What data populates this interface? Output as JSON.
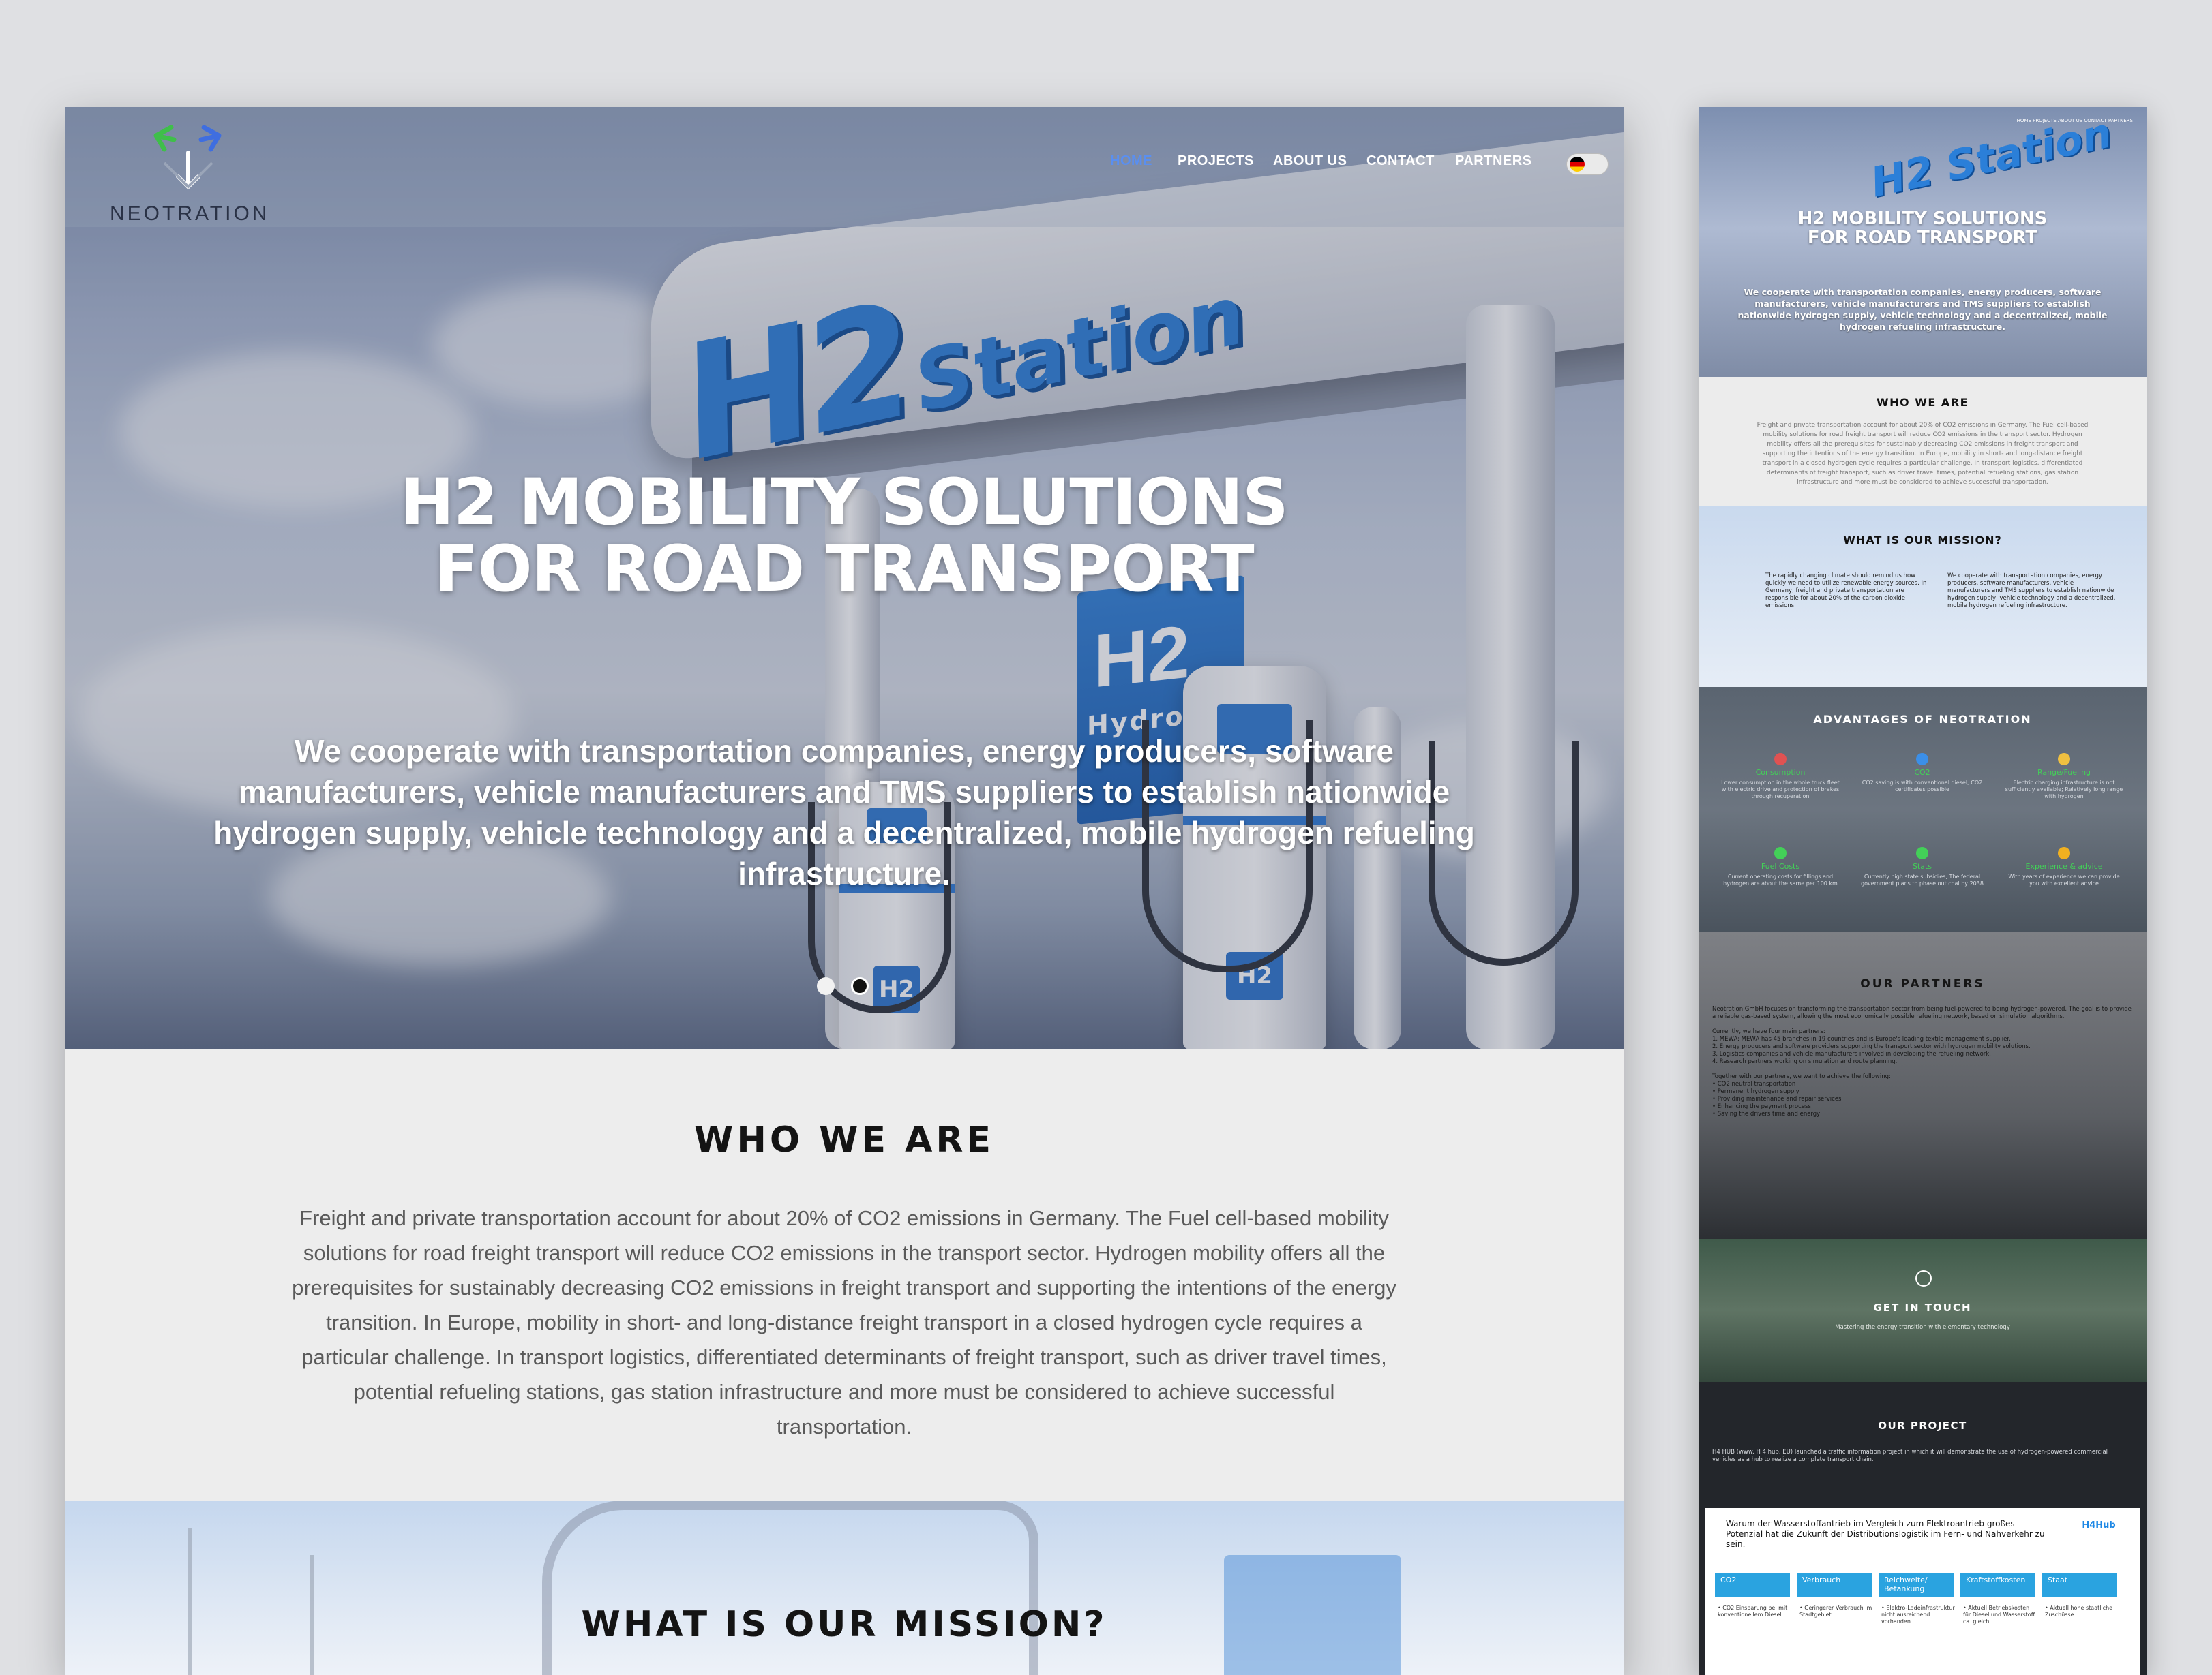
{
  "main": {
    "logo": {
      "text": "NEOTRATION",
      "icon": "neotration-logo-icon"
    },
    "nav": [
      {
        "label": "HOME",
        "active": true
      },
      {
        "label": "PROJECTS",
        "active": false
      },
      {
        "label": "ABOUT US",
        "active": false
      },
      {
        "label": "CONTACT",
        "active": false
      },
      {
        "label": "PARTNERS",
        "active": false
      }
    ],
    "language_toggle": {
      "icon": "german-flag-icon"
    },
    "hero": {
      "sign_h2": "H2",
      "sign_station": "Station",
      "box_h2": "H2",
      "box_hydrogen": "Hydrogen",
      "pump_badge": "H2",
      "title_line1": "H2 MOBILITY SOLUTIONS",
      "title_line2": "FOR ROAD TRANSPORT",
      "subtitle": "We cooperate with transportation companies, energy producers, software manufacturers, vehicle manufacturers and TMS suppliers to establish nationwide hydrogen supply, vehicle technology and a decentralized, mobile hydrogen refueling infrastructure.",
      "slides": 2,
      "active_slide": 2
    },
    "who_we_are": {
      "heading": "WHO WE ARE",
      "text": "Freight and private transportation account for about 20% of CO2 emissions in Germany. The Fuel cell-based mobility solutions for road freight transport will reduce CO2 emissions in the transport sector. Hydrogen mobility offers all the prerequisites for sustainably decreasing CO2 emissions in freight transport and supporting the intentions of the energy transition. In Europe, mobility in short- and long-distance freight transport in a closed hydrogen cycle requires a particular challenge. In transport logistics, differentiated determinants of freight transport, such as driver travel times, potential refueling stations, gas station infrastructure and more must be considered to achieve successful transportation."
    },
    "mission": {
      "heading": "WHAT IS OUR MISSION?"
    },
    "colors": {
      "accent": "#5a8ff0",
      "brand_blue": "#2b7fd8",
      "section_bg": "#ededed"
    }
  },
  "thumbnail": {
    "hero_title_1": "H2 MOBILITY SOLUTIONS",
    "hero_title_2": "FOR ROAD TRANSPORT",
    "hero_sign": "H2 Station",
    "hero_sub": "We cooperate with transportation companies, energy producers, software manufacturers, vehicle manufacturers and TMS suppliers to establish nationwide hydrogen supply, vehicle technology and a decentralized, mobile hydrogen refueling infrastructure.",
    "who_heading": "WHO WE ARE",
    "who_text": "Freight and private transportation account for about 20% of CO2 emissions in Germany. The Fuel cell-based mobility solutions for road freight transport will reduce CO2 emissions in the transport sector. Hydrogen mobility offers all the prerequisites for sustainably decreasing CO2 emissions in freight transport and supporting the intentions of the energy transition. In Europe, mobility in short- and long-distance freight transport in a closed hydrogen cycle requires a particular challenge. In transport logistics, differentiated determinants of freight transport, such as driver travel times, potential refueling stations, gas station infrastructure and more must be considered to achieve successful transportation.",
    "mission_heading": "WHAT IS OUR MISSION?",
    "advantages_heading": "ADVANTAGES OF NEOTRATION",
    "advantages": [
      {
        "label": "Consumption",
        "color": "#e05252"
      },
      {
        "label": "CO2",
        "color": "#3b8fe8"
      },
      {
        "label": "Range/Fueling",
        "color": "#f0c040"
      },
      {
        "label": "Fuel Costs",
        "color": "#43d058"
      },
      {
        "label": "Stats",
        "color": "#43d058"
      },
      {
        "label": "Experience & advice",
        "color": "#f0b020"
      }
    ],
    "partners_heading": "OUR PARTNERS",
    "touch_heading": "GET IN TOUCH",
    "touch_text": "Mastering the energy transition with elementary technology",
    "project_heading": "OUR PROJECT",
    "project_text": "H4 HUB (www. H 4 hub. EU) launched a traffic information project in which it will demonstrate the use of hydrogen-powered commercial vehicles as a hub to realize a complete transport chain.",
    "project_card": {
      "heading": "Warum der Wasserstoffantrieb im Vergleich zum Elektroantrieb großes Potenzial hat die Zukunft der Distributionslogistik im Fern- und Nahverkehr zu sein.",
      "logo": "H4Hub",
      "columns": [
        "CO2",
        "Verbrauch",
        "Reichweite/ Betankung",
        "Kraftstoffkosten",
        "Staat"
      ]
    }
  }
}
